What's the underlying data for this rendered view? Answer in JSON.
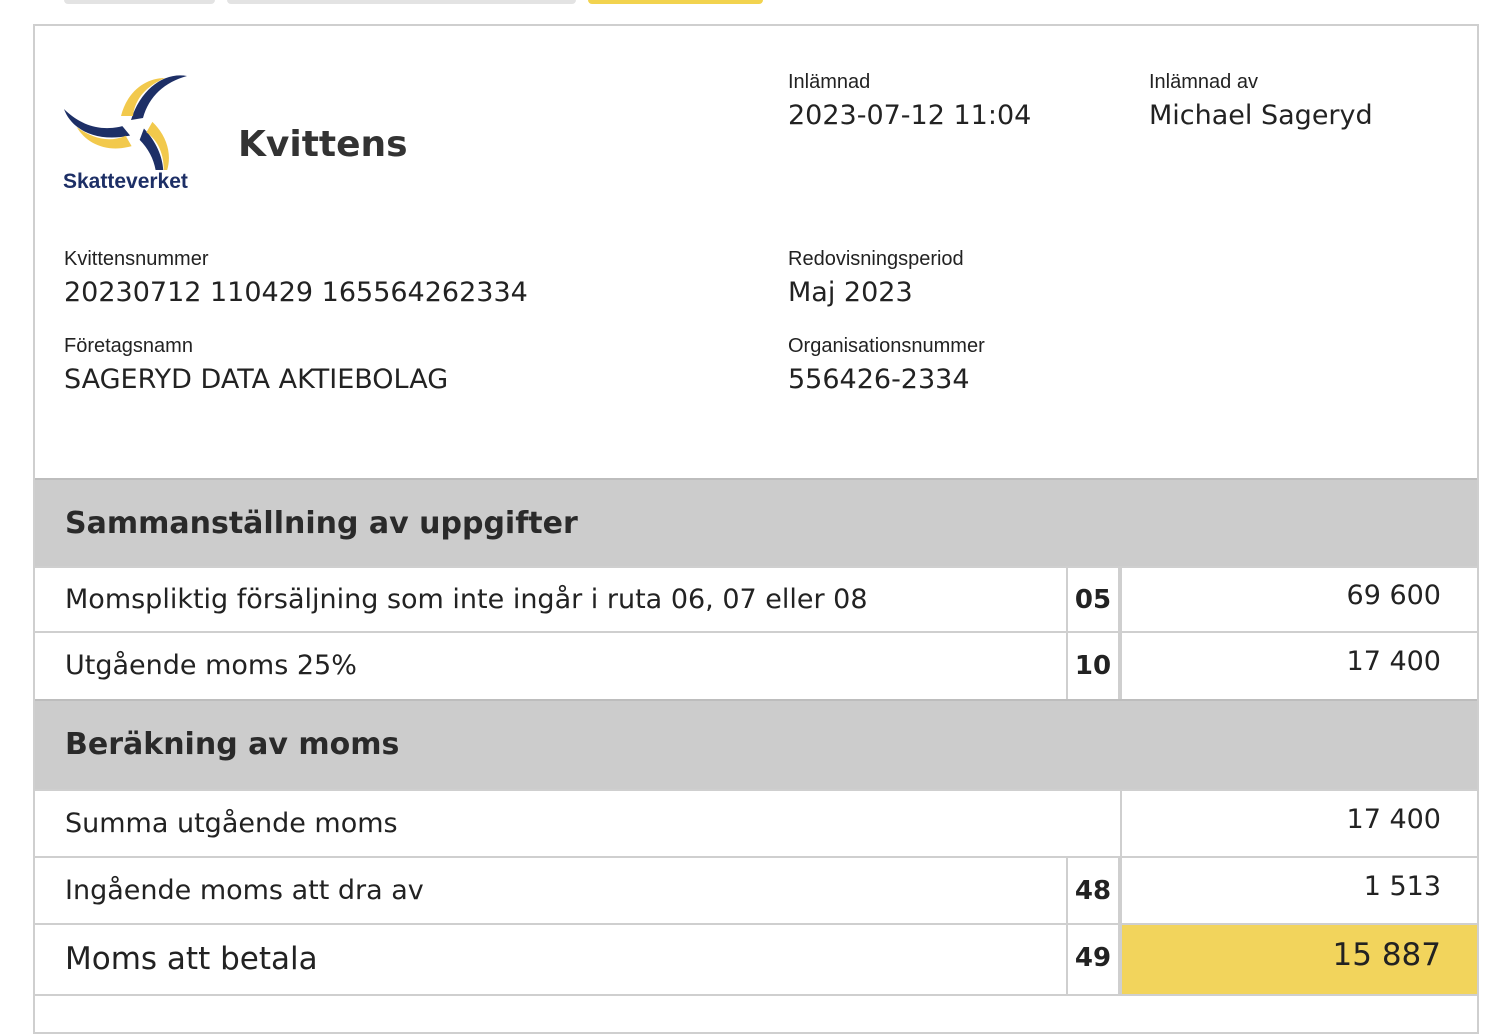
{
  "colors": {
    "accent_yellow": "#f2d45c",
    "section_gray": "#cccccc",
    "logo_navy": "#1d2f66",
    "logo_yellow": "#f2c94c"
  },
  "logo": {
    "icon": "skatteverket-logo-icon",
    "text": "Skatteverket"
  },
  "header": {
    "title": "Kvittens",
    "submitted": {
      "label": "Inlämnad",
      "value": "2023-07-12 11:04"
    },
    "submitted_by": {
      "label": "Inlämnad av",
      "value": "Michael Sageryd"
    },
    "receipt_number": {
      "label": "Kvittensnummer",
      "value": "20230712 110429 165564262334"
    },
    "period": {
      "label": "Redovisningsperiod",
      "value": "Maj 2023"
    },
    "company": {
      "label": "Företagsnamn",
      "value": "SAGERYD DATA AKTIEBOLAG"
    },
    "org_number": {
      "label": "Organisationsnummer",
      "value": "556426-2334"
    }
  },
  "summary": {
    "title": "Sammanställning av uppgifter",
    "rows": [
      {
        "description": "Momspliktig försäljning som inte ingår i ruta 06, 07 eller 08",
        "code": "05",
        "amount": "69 600"
      },
      {
        "description": "Utgående moms 25%",
        "code": "10",
        "amount": "17 400"
      }
    ]
  },
  "calculation": {
    "title": "Beräkning av moms",
    "rows": [
      {
        "description": "Summa utgående moms",
        "code": "",
        "amount": "17 400"
      },
      {
        "description": "Ingående moms att dra av",
        "code": "48",
        "amount": "1 513"
      },
      {
        "description": "Moms att betala",
        "code": "49",
        "amount": "15 887"
      }
    ]
  }
}
